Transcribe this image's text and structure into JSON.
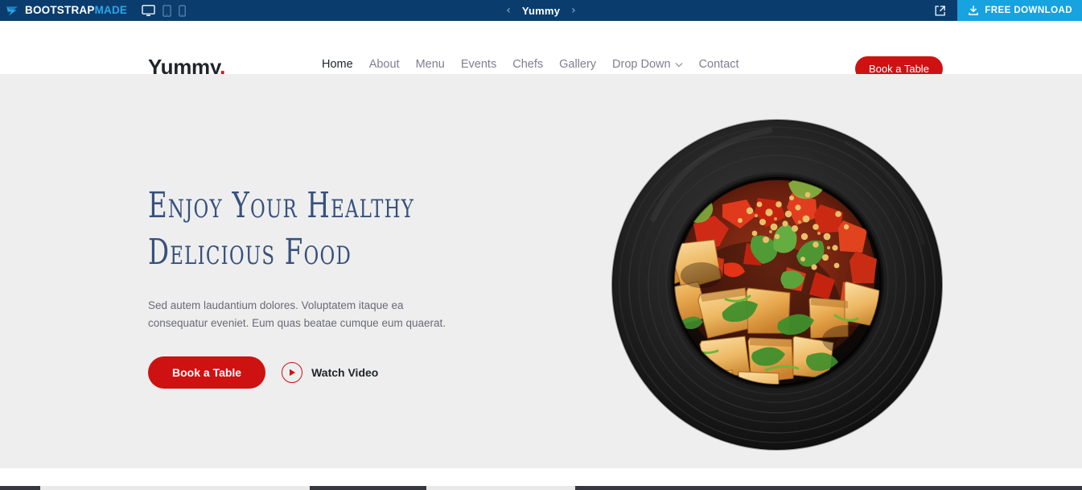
{
  "preview_bar": {
    "logo": {
      "icon": "bootstrapmade-logo-icon",
      "text_bold": "BOOTSTRAP",
      "text_light": "MADE"
    },
    "device_icons": [
      {
        "name": "desktop-icon",
        "active": true
      },
      {
        "name": "tablet-icon",
        "active": false
      },
      {
        "name": "mobile-icon",
        "active": false
      }
    ],
    "prev_arrow": "‹",
    "title": "Yummy",
    "next_arrow": "›",
    "external_link_icon": "external-link-icon",
    "download_icon": "download-icon",
    "download_label": "FREE DOWNLOAD",
    "bg_color": "#0a3d6e",
    "download_color": "#17a2e0",
    "accent_color": "#2aa7e8"
  },
  "header": {
    "brand": "Yummy",
    "brand_dot": ".",
    "nav": [
      {
        "label": "Home",
        "active": true
      },
      {
        "label": "About",
        "active": false
      },
      {
        "label": "Menu",
        "active": false
      },
      {
        "label": "Events",
        "active": false
      },
      {
        "label": "Chefs",
        "active": false
      },
      {
        "label": "Gallery",
        "active": false
      },
      {
        "label": "Drop Down",
        "active": false,
        "has_caret": true
      },
      {
        "label": "Contact",
        "active": false
      }
    ],
    "cta_label": "Book a Table",
    "accent_color": "#ce1212",
    "bg_color": "#ffffff"
  },
  "hero": {
    "title_line1": "Enjoy Your Healthy",
    "title_line2": "Delicious Food",
    "description": "Sed autem laudantium dolores. Voluptatem itaque ea consequatur eveniet. Eum quas beatae cumque eum quaerat.",
    "primary_button": "Book a Table",
    "video_label": "Watch Video",
    "play_icon": "play-icon",
    "bg_color": "#eeeeee",
    "title_color": "#37517e",
    "image": {
      "name": "food-plate-image",
      "alt": "Black plate of fried tofu with red peppers, peanuts and fresh herbs"
    }
  }
}
